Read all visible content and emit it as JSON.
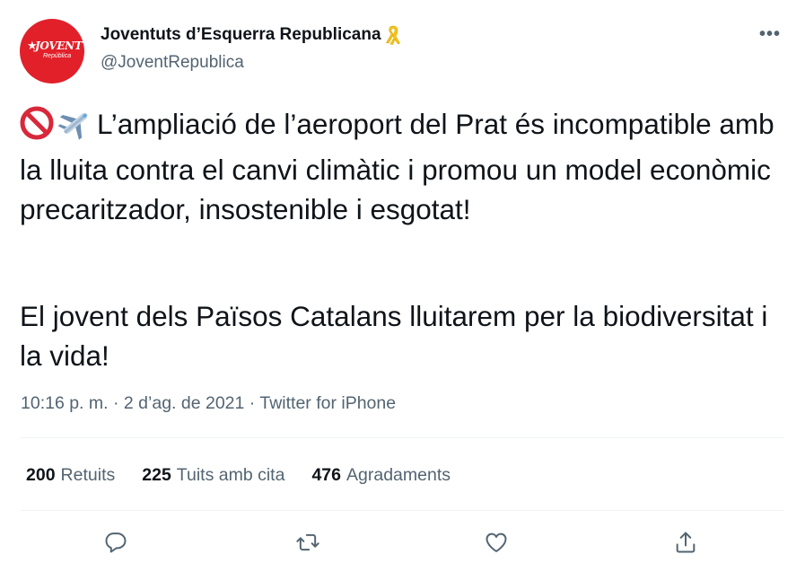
{
  "author": {
    "display_name": "Joventuts d’Esquerra Republicana",
    "handle": "@JoventRepublica",
    "avatar_text": "JOVENT",
    "avatar_subtext": "República",
    "name_badge_icon": "yellow-ribbon-icon"
  },
  "tweet": {
    "paragraph1_lead_emojis": [
      "prohibited-icon",
      "airplane-icon"
    ],
    "paragraph1": "L’ampliació de l’aeroport del Prat és incompatible amb la lluita contra el canvi climàtic i promou un model econòmic precaritzador, insostenible i esgotat!",
    "paragraph2": "El jovent dels Països Catalans lluitarem per la biodiversitat i la vida!",
    "time": "10:16 p. m.",
    "date": "2 d’ag. de 2021",
    "source": "Twitter for iPhone",
    "separator": "·"
  },
  "stats": {
    "retweets_count": "200",
    "retweets_label": "Retuits",
    "quotes_count": "225",
    "quotes_label": "Tuits amb cita",
    "likes_count": "476",
    "likes_label": "Agradaments"
  },
  "actions": [
    "reply-icon",
    "retweet-icon",
    "like-icon",
    "share-icon"
  ],
  "colors": {
    "text": "#0f1419",
    "secondary": "#536471",
    "divider": "#eff3f4",
    "avatar_red": "#e2202a",
    "ribbon_yellow": "#f5c518"
  }
}
